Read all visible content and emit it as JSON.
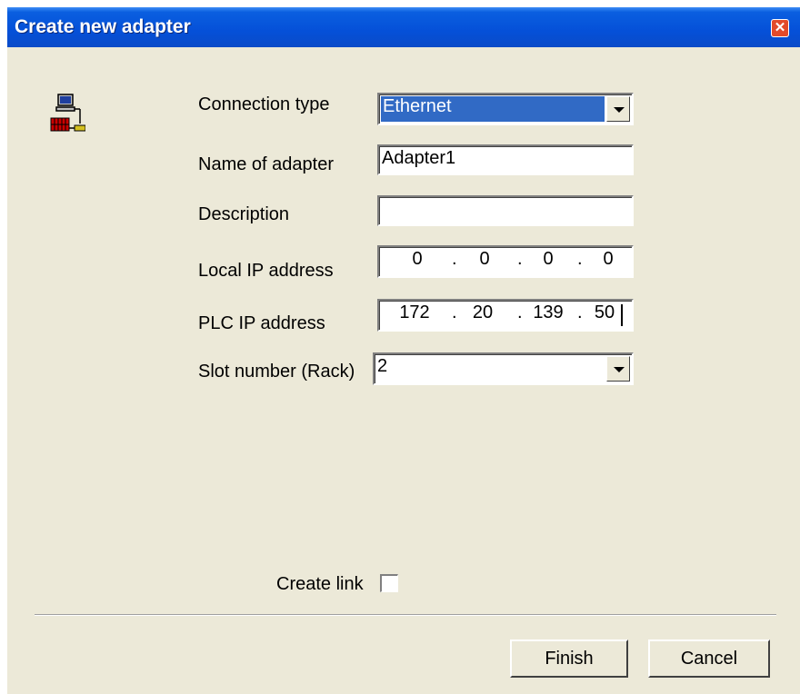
{
  "window": {
    "title": "Create new adapter"
  },
  "form": {
    "connection_type_label": "Connection type",
    "connection_type_value": "Ethernet",
    "adapter_name_label": "Name of adapter",
    "adapter_name_value": "Adapter1",
    "description_label": "Description",
    "description_value": "",
    "local_ip_label": "Local IP address",
    "local_ip": [
      "0",
      "0",
      "0",
      "0"
    ],
    "plc_ip_label": "PLC IP address",
    "plc_ip": [
      "172",
      "20",
      "139",
      "50"
    ],
    "slot_label": "Slot number (Rack)",
    "slot_value": "2",
    "create_link_label": "Create link",
    "create_link_checked": false
  },
  "buttons": {
    "finish": "Finish",
    "cancel": "Cancel"
  },
  "icons": {
    "title_close": "close-icon",
    "adapter": "network-adapter-icon",
    "dropdown": "chevron-down-icon"
  }
}
